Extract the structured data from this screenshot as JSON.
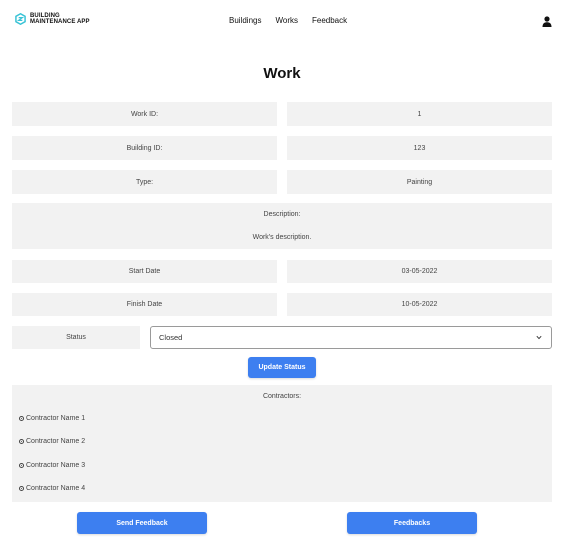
{
  "app": {
    "name_line1": "BUILDING",
    "name_line2": "MAINTENANCE APP",
    "accent_color": "#3d7ff0"
  },
  "nav": {
    "items": [
      {
        "label": "Buildings"
      },
      {
        "label": "Works"
      },
      {
        "label": "Feedback"
      }
    ],
    "user_icon": "user-icon"
  },
  "page": {
    "title": "Work"
  },
  "fields": {
    "work_id": {
      "label": "Work ID:",
      "value": "1"
    },
    "building_id": {
      "label": "Building ID:",
      "value": "123"
    },
    "type": {
      "label": "Type:",
      "value": "Painting"
    },
    "description": {
      "label": "Description:",
      "value": "Work's description."
    },
    "start_date": {
      "label": "Start Date",
      "value": "03-05-2022"
    },
    "finish_date": {
      "label": "Finish Date",
      "value": "10-05-2022"
    }
  },
  "status": {
    "label": "Status",
    "selected": "Closed",
    "update_button": "Update Status"
  },
  "contractors": {
    "title": "Contractors:",
    "items": [
      {
        "name": "Contractor Name 1"
      },
      {
        "name": "Contractor Name 2"
      },
      {
        "name": "Contractor Name 3"
      },
      {
        "name": "Contractor Name 4"
      }
    ]
  },
  "actions": {
    "send_feedback": "Send Feedback",
    "feedbacks": "Feedbacks"
  }
}
